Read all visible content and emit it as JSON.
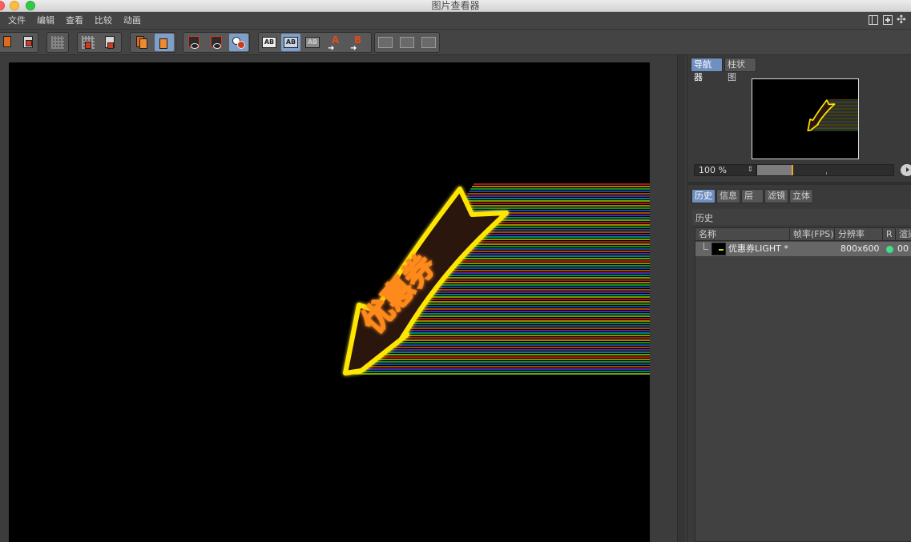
{
  "window": {
    "title": "图片查看器"
  },
  "menu": {
    "items": [
      "文件",
      "编辑",
      "查看",
      "比较",
      "动画"
    ]
  },
  "toolbar": {
    "compare_a_label": "A",
    "compare_b_label": "B",
    "ab_text": "AB"
  },
  "navigator": {
    "tabs": [
      "导航器",
      "柱状图"
    ],
    "zoom_value": "100 %",
    "zoom_level_fraction": 0.25
  },
  "history_panel": {
    "tabs": [
      "历史",
      "信息",
      "层",
      "滤镜",
      "立体"
    ],
    "section_title": "历史",
    "columns": [
      "名称",
      "帧率(FPS)",
      "分辨率",
      "R",
      "渲染"
    ],
    "rows": [
      {
        "name": "优惠券LIGHT *",
        "fps": "",
        "resolution": "800x600",
        "status_color": "#3fe08a",
        "render": "00"
      }
    ]
  },
  "image": {
    "text": "优惠券",
    "colors": {
      "neon_outline": "#ffe600",
      "neon_text": "#ff8a1a",
      "arrow_fill": "#2a140c"
    }
  },
  "colors": {
    "active_tab": "#6f8fbf",
    "panel_bg": "#3a3a3a"
  }
}
